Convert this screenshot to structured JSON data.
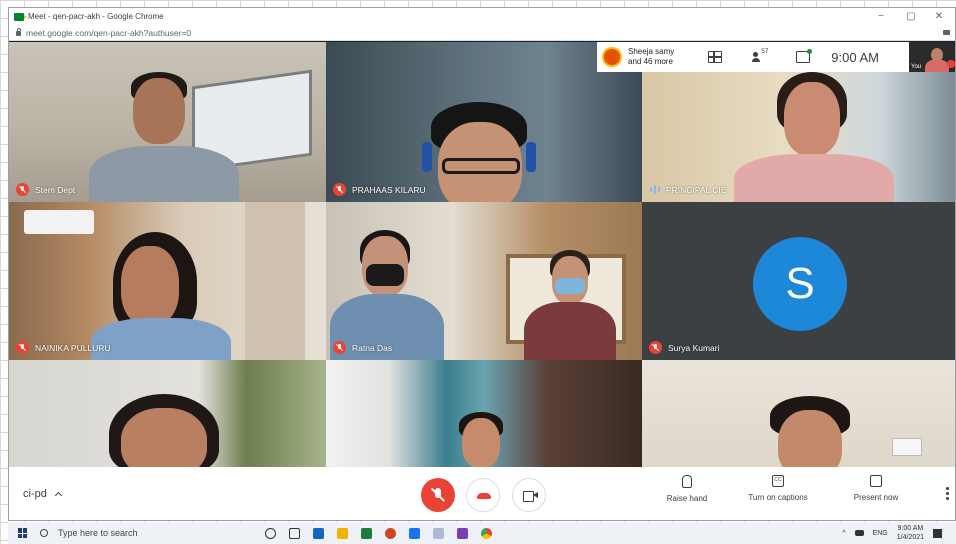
{
  "window": {
    "title": "Meet - qen-pacr-akh - Google Chrome",
    "controls": [
      "−",
      "▢",
      "✕"
    ]
  },
  "address": {
    "url": "meet.google.com/qen-pacr-akh?authuser=0"
  },
  "top_info": {
    "presenter_line1": "Sheeja samy",
    "presenter_line2": "and 46 more",
    "people_count": "57",
    "time": "9:00 AM",
    "you_label": "You"
  },
  "participants": [
    {
      "name": "Stem Dept",
      "muted": true
    },
    {
      "name": "PRAHAAS KILARU",
      "muted": true
    },
    {
      "name": "PRINCIPAL CIE",
      "muted": false
    },
    {
      "name": "NAINIKA PULLURU",
      "muted": true
    },
    {
      "name": "Ratna Das",
      "muted": true
    },
    {
      "name": "Surya Kumari",
      "muted": true,
      "initial": "S",
      "avatar_color": "#1e88d8"
    },
    {
      "name": "",
      "muted": false
    },
    {
      "name": "",
      "muted": false
    },
    {
      "name": "",
      "muted": false
    }
  ],
  "bottom": {
    "meeting_code": "ci-pd",
    "raise_hand": "Raise hand",
    "captions": "Turn on captions",
    "captions_icon": "CC",
    "present": "Present now"
  },
  "taskbar": {
    "search_placeholder": "Type here to search",
    "lang": "ENG",
    "time": "9:00 AM",
    "date": "1/4/2021"
  },
  "colors": {
    "mute_red": "#ea4335",
    "window_bg": "#202124",
    "avatar_blue": "#1e88d8"
  }
}
